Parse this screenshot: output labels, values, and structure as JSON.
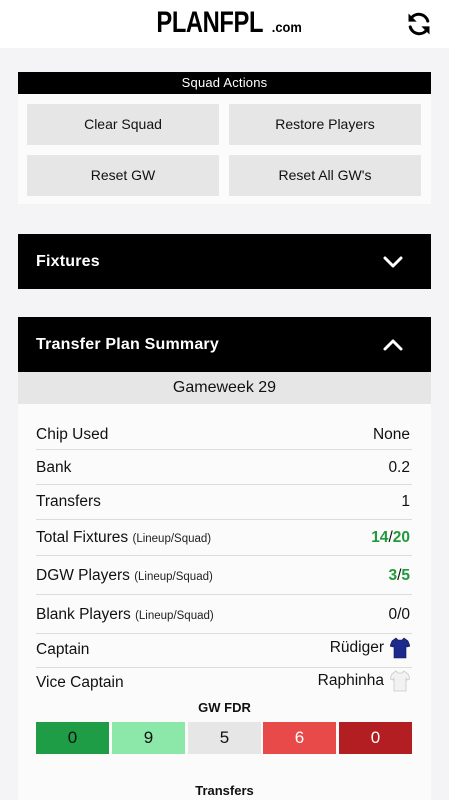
{
  "header": {
    "logo_main": "PLANFPL",
    "logo_suffix": ".com",
    "refresh_icon": "refresh-icon"
  },
  "squad_actions": {
    "title": "Squad Actions",
    "buttons": [
      "Clear Squad",
      "Restore Players",
      "Reset GW",
      "Reset All GW's"
    ]
  },
  "fixtures": {
    "title": "Fixtures",
    "icon": "chevron-down-icon"
  },
  "summary": {
    "title": "Transfer Plan Summary",
    "icon": "chevron-up-icon",
    "gameweek": "Gameweek 29",
    "rows": {
      "chip_label": "Chip Used",
      "chip_value": "None",
      "bank_label": "Bank",
      "bank_value": "0.2",
      "transfers_label": "Transfers",
      "transfers_value": "1",
      "total_fixtures_label": "Total Fixtures",
      "total_fixtures_sub": "(Lineup/Squad)",
      "total_fixtures_lineup": "14",
      "total_fixtures_squad": "20",
      "dgw_label": "DGW Players",
      "dgw_sub": "(Lineup/Squad)",
      "dgw_lineup": "3",
      "dgw_squad": "5",
      "blank_label": "Blank Players",
      "blank_sub": "(Lineup/Squad)",
      "blank_lineup": "0",
      "blank_squad": "0",
      "captain_label": "Captain",
      "captain_value": "Rüdiger",
      "vice_label": "Vice Captain",
      "vice_value": "Raphinha"
    },
    "separator": "/",
    "gw_fdr": {
      "title": "GW FDR",
      "values": [
        "0",
        "9",
        "5",
        "6",
        "0"
      ],
      "colors": [
        "#1e9c46",
        "#8be8a8",
        "#e6e6e6",
        "#e84a4a",
        "#b21e22"
      ],
      "text_colors": [
        "#111",
        "#111",
        "#111",
        "#fff",
        "#fff"
      ]
    },
    "transfers_title": "Transfers"
  },
  "colors": {
    "accent_green": "#1f9a3a",
    "header_black": "#000000",
    "captain_shirt": "#1c2a8c",
    "vice_shirt": "#f2f2f2"
  }
}
